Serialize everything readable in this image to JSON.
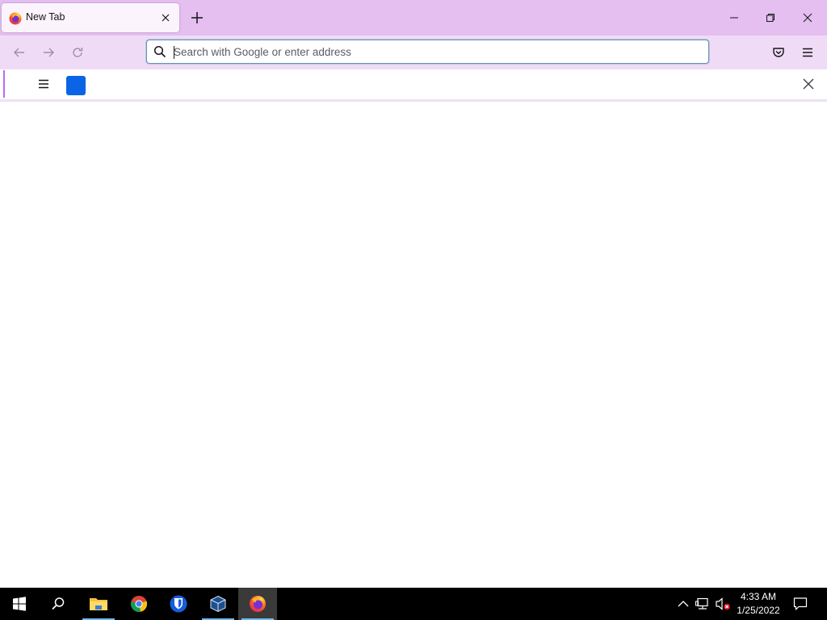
{
  "browser": {
    "tab": {
      "title": "New Tab",
      "favicon": "firefox-icon",
      "close_icon": "close-icon"
    },
    "new_tab_icon": "plus-icon",
    "window_controls": [
      "minimize-icon",
      "restore-icon",
      "close-icon"
    ],
    "toolbar": {
      "back_icon": "arrow-left-icon",
      "forward_icon": "arrow-right-icon",
      "reload_icon": "reload-icon",
      "url": {
        "value": "",
        "placeholder": "Search with Google or enter address",
        "search_icon": "search-icon"
      },
      "pocket_icon": "pocket-icon",
      "menu_icon": "hamburger-menu-icon"
    },
    "notification_bar": {
      "menu_icon": "hamburger-menu-icon",
      "square_color": "#0a64e6",
      "close_icon": "close-icon"
    },
    "colors": {
      "tabstrip": "#e4bff0",
      "toolbar": "#f0dbf7",
      "accent": "#b86cf0"
    }
  },
  "taskbar": {
    "items": [
      "windows-start-icon",
      "search-icon",
      "file-explorer-icon",
      "chrome-icon",
      "bitwarden-icon",
      "virtualbox-icon",
      "firefox-icon"
    ],
    "tray": {
      "icons": [
        "chevron-up-icon",
        "network-icon",
        "volume-muted-icon"
      ],
      "time": "4:33 AM",
      "date": "1/25/2022",
      "notifications_icon": "action-center-icon"
    }
  }
}
